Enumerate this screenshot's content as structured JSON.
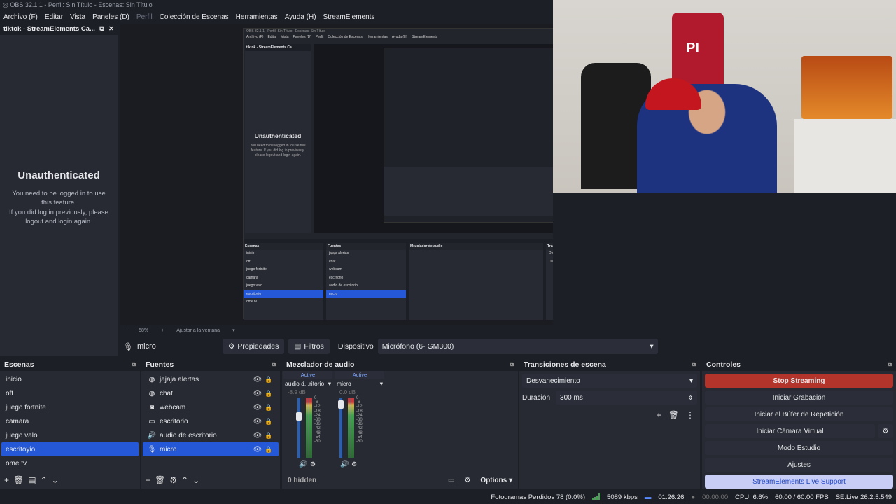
{
  "window_title": "OBS 32.1.1 - Perfil: Sin Título - Escenas: Sin Título",
  "menu": [
    "Archivo (F)",
    "Editar",
    "Vista",
    "Paneles (D)",
    "Perfil",
    "Colección de Escenas",
    "Herramientas",
    "Ayuda (H)",
    "StreamElements"
  ],
  "auth_dock": {
    "title": "tiktok - StreamElements Ca...",
    "heading": "Unauthenticated",
    "msg1": "You need to be logged in to use this feature.",
    "msg2": "If you did log in previously, please logout and login again."
  },
  "preview": {
    "zoom": "58%",
    "fit": "Ajustar a la ventana"
  },
  "source_bar": {
    "source_name": "micro",
    "properties": "Propiedades",
    "filters": "Filtros",
    "device_label": "Dispositivo",
    "device_value": "Micrófono (6- GM300)"
  },
  "scenes": {
    "title": "Escenas",
    "items": [
      "inicio",
      "off",
      "juego fortnite",
      "camara",
      "juego valo",
      "escritoyio",
      "ome tv"
    ],
    "selected": 5
  },
  "sources": {
    "title": "Fuentes",
    "items": [
      {
        "label": "jajaja alertas",
        "icon": "globe-icon"
      },
      {
        "label": "chat",
        "icon": "globe-icon"
      },
      {
        "label": "webcam",
        "icon": "camera-icon"
      },
      {
        "label": "escritorio",
        "icon": "monitor-icon"
      },
      {
        "label": "audio de escritorio",
        "icon": "speaker-icon"
      },
      {
        "label": "micro",
        "icon": "mic-icon"
      }
    ],
    "selected": 5
  },
  "mixer": {
    "title": "Mezclador de audio",
    "channels": [
      {
        "status": "Active",
        "name": "audio d...ritorio",
        "db": "-8.9 dB",
        "level": 0.72
      },
      {
        "status": "Active",
        "name": "micro",
        "db": "0.0 dB",
        "level": 0.95
      }
    ],
    "ticks": [
      "0",
      "-6",
      "-12",
      "-18",
      "-24",
      "-30",
      "-36",
      "-42",
      "-48",
      "-54",
      "-60"
    ],
    "hidden": "0 hidden",
    "options": "Options"
  },
  "transitions": {
    "title": "Transiciones de escena",
    "selected": "Desvanecimiento",
    "duration_label": "Duración",
    "duration_value": "300 ms"
  },
  "controls": {
    "title": "Controles",
    "stop_streaming": "Stop Streaming",
    "start_recording": "Iniciar Grabación",
    "replay_buffer": "Iniciar el Búfer de Repetición",
    "virtual_camera": "Iniciar Cámara Virtual",
    "studio_mode": "Modo Estudio",
    "settings": "Ajustes",
    "support": "StreamElements Live Support"
  },
  "status": {
    "dropped": "Fotogramas Perdidos 78 (0.0%)",
    "bitrate": "5089 kbps",
    "stream_time": "01:26:26",
    "rec_time": "00:00:00",
    "cpu": "CPU: 6.6%",
    "fps": "60.00 / 60.00 FPS",
    "version": "SE.Live 26.2.5.549"
  },
  "colors": {
    "accent": "#2458d6",
    "stop": "#b3342a",
    "support_bg": "#c8cdf6"
  }
}
